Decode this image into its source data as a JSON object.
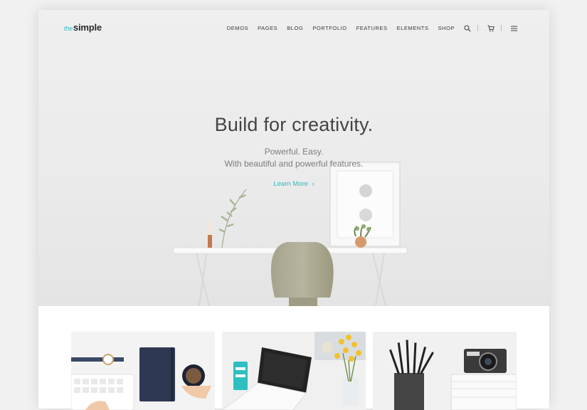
{
  "brand": {
    "logo_prefix": "the",
    "logo_name": "simple"
  },
  "nav": {
    "items": [
      {
        "label": "DEMOS"
      },
      {
        "label": "PAGES"
      },
      {
        "label": "BLOG"
      },
      {
        "label": "PORTFOLIO"
      },
      {
        "label": "FEATURES"
      },
      {
        "label": "ELEMENTS"
      },
      {
        "label": "SHOP"
      }
    ],
    "icons": [
      "search-icon",
      "cart-icon",
      "hamburger-menu-icon"
    ]
  },
  "hero": {
    "headline": "Build for creativity.",
    "subline_1": "Powerful. Easy.",
    "subline_2": "With beautiful and powerful features.",
    "cta_label": "Learn More",
    "cta_icon": "chevron-right-icon"
  },
  "colors": {
    "accent": "#2bbcc4",
    "text_dark": "#444444",
    "text_muted": "#7d7d7d",
    "background": "#f1f1f1"
  },
  "cards": [
    {
      "image": "desk-flatlay-notebook-coffee-photo"
    },
    {
      "image": "laptop-yellow-flowers-photo"
    },
    {
      "image": "pencil-cup-camera-books-photo"
    }
  ]
}
